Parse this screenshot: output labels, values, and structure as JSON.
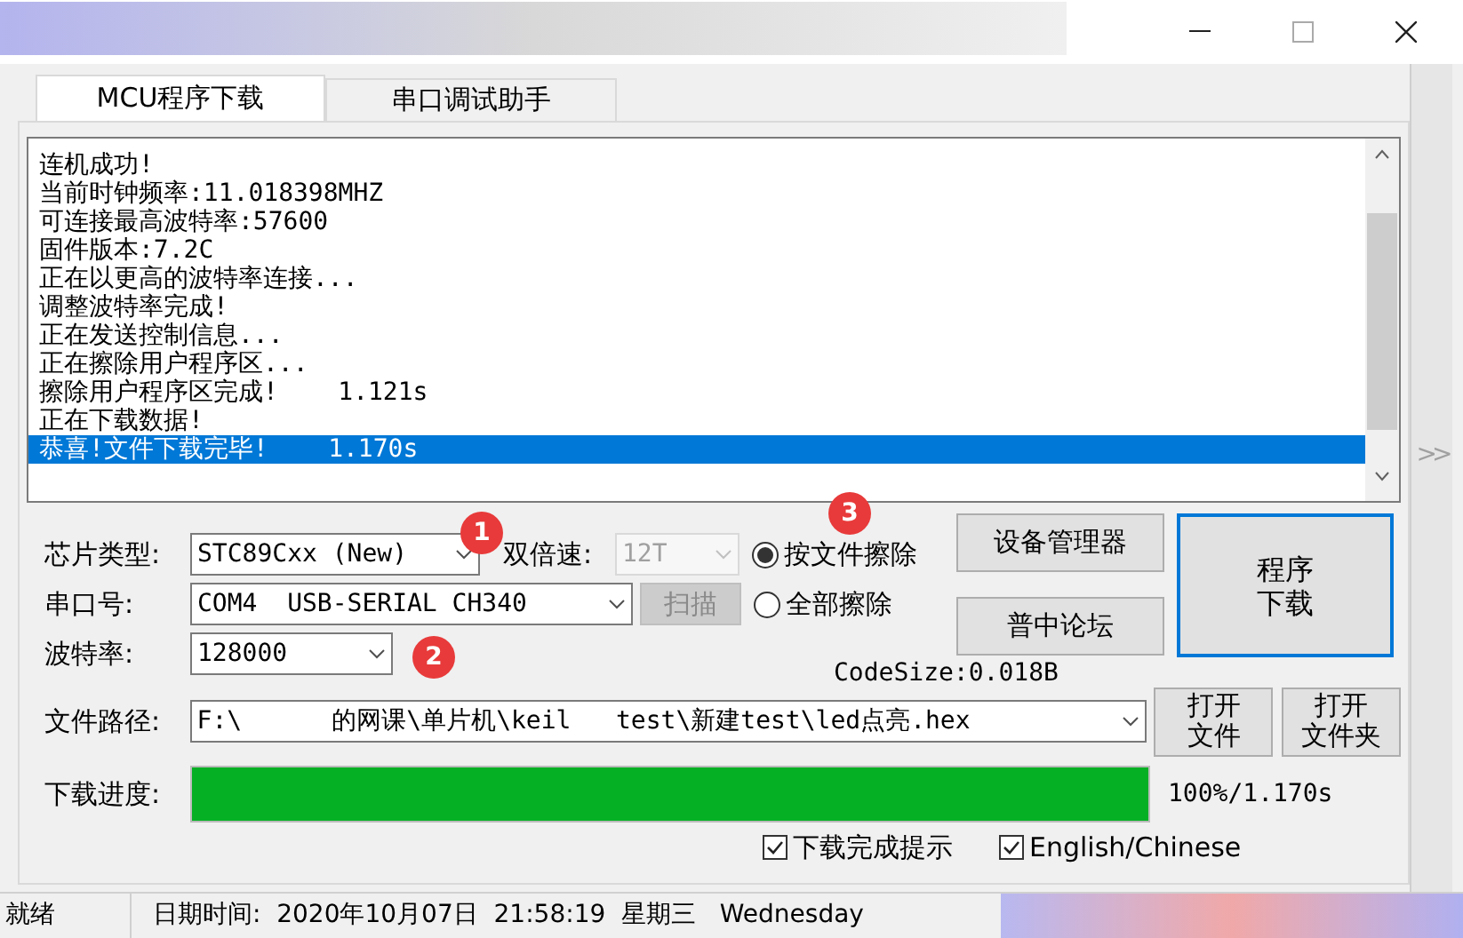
{
  "tabs": [
    {
      "label": "MCU程序下载",
      "selected": true
    },
    {
      "label": "串口调试助手",
      "selected": false
    }
  ],
  "log": {
    "lines": [
      {
        "text": "连机成功!",
        "selected": false
      },
      {
        "text": "当前时钟频率:11.018398MHZ",
        "selected": false
      },
      {
        "text": "可连接最高波特率:57600",
        "selected": false
      },
      {
        "text": "固件版本:7.2C",
        "selected": false
      },
      {
        "text": "正在以更高的波特率连接...",
        "selected": false
      },
      {
        "text": "调整波特率完成!",
        "selected": false
      },
      {
        "text": "正在发送控制信息...",
        "selected": false
      },
      {
        "text": "正在擦除用户程序区...",
        "selected": false
      },
      {
        "text": "擦除用户程序区完成!    1.121s",
        "selected": false
      },
      {
        "text": "正在下载数据!",
        "selected": false
      },
      {
        "text": "恭喜!文件下载完毕!    1.170s",
        "selected": true
      }
    ]
  },
  "chip_type": {
    "label": "芯片类型:",
    "value": "STC89Cxx (New)"
  },
  "double_speed": {
    "label": "双倍速:",
    "value": "12T",
    "disabled": true
  },
  "port": {
    "label": "串口号:",
    "value": "COM4  USB-SERIAL CH340"
  },
  "scan_button": {
    "label": "扫描",
    "disabled": true
  },
  "baud_rate": {
    "label": "波特率:",
    "value": "128000"
  },
  "erase_options": [
    {
      "label": "按文件擦除",
      "selected": true
    },
    {
      "label": "全部擦除",
      "selected": false
    }
  ],
  "device_manager_button": {
    "label": "设备管理器"
  },
  "forum_button": {
    "label": "普中论坛"
  },
  "download_button": {
    "lines": [
      "程序",
      "下载"
    ],
    "focused": true
  },
  "code_size": "CodeSize:0.018B",
  "file_path": {
    "label": "文件路径:",
    "value": "F:\\      的网课\\单片机\\keil   test\\新建test\\led点亮.hex"
  },
  "open_buttons": [
    {
      "lines": [
        "打开",
        "文件"
      ]
    },
    {
      "lines": [
        "打开",
        "文件夹"
      ]
    }
  ],
  "progress": {
    "label": "下载进度:",
    "level": 1.0,
    "reading": "100%/1.170s"
  },
  "options": [
    {
      "label": "下载完成提示",
      "checked": true
    },
    {
      "label": "English/Chinese",
      "checked": true
    }
  ],
  "side_toggle": ">>",
  "status_bar": {
    "status": "就绪",
    "datetime": "日期时间:  2020年10月07日  21:58:19  星期三   Wednesday"
  },
  "annotations": [
    {
      "label": "1"
    },
    {
      "label": "2"
    },
    {
      "label": "3"
    }
  ]
}
